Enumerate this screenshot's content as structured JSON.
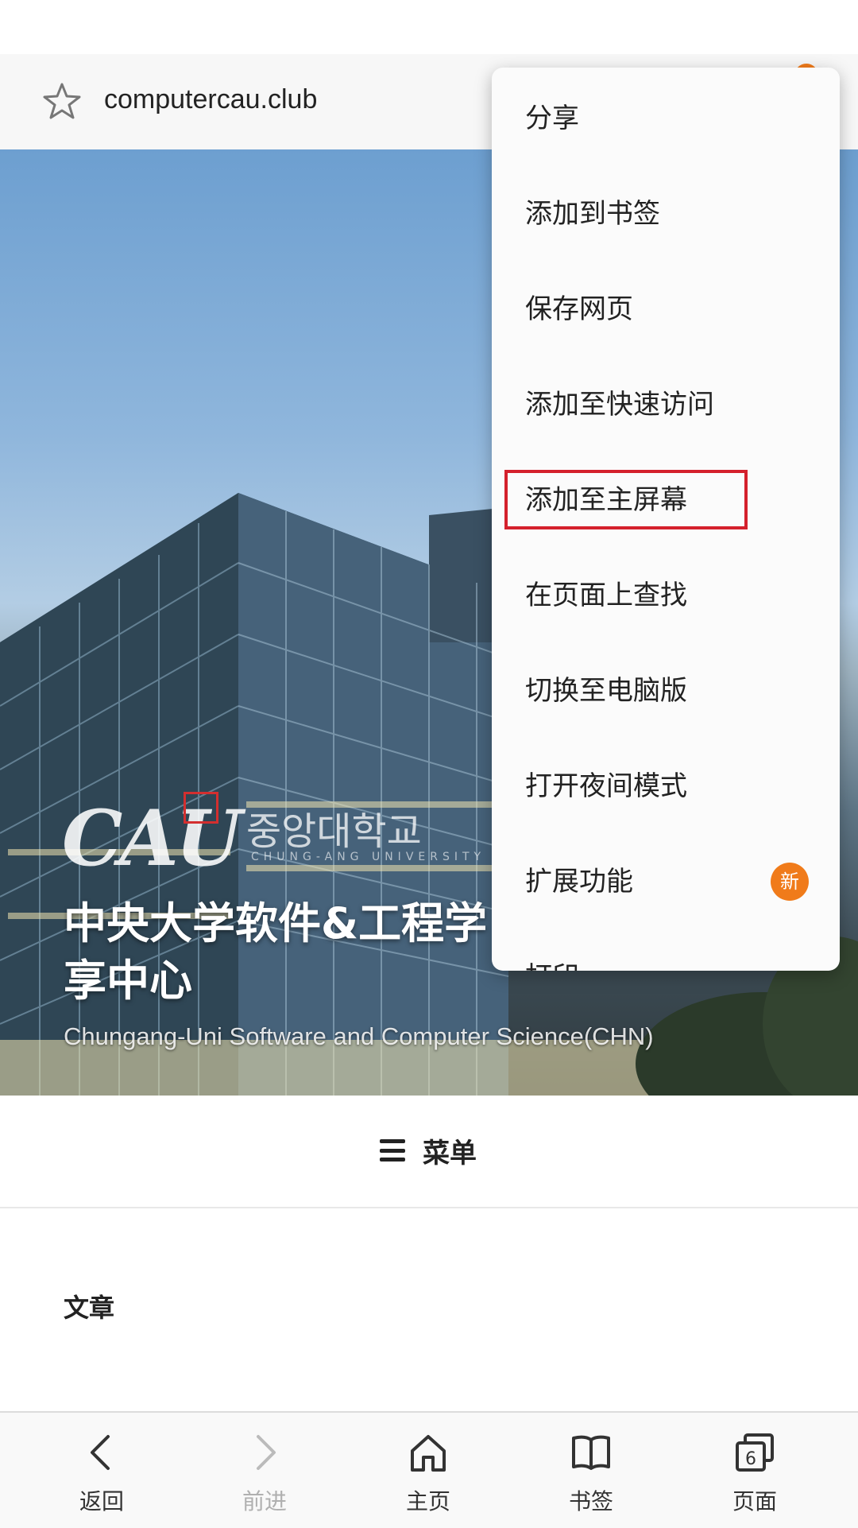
{
  "browser": {
    "url": "computercau.club"
  },
  "hero": {
    "logo_text": "CAU",
    "logo_korean": "중앙대학교",
    "logo_korean_sub": "CHUNG-ANG UNIVERSITY",
    "title_line1": "中央大学软件&工程学",
    "title_line2": "享中心",
    "subtitle": "Chungang-Uni Software and Computer Science(CHN)"
  },
  "page": {
    "menu_label": "菜单",
    "articles_heading": "文章"
  },
  "context_menu": {
    "items": [
      {
        "label": "分享"
      },
      {
        "label": "添加到书签"
      },
      {
        "label": "保存网页"
      },
      {
        "label": "添加至快速访问"
      },
      {
        "label": "添加至主屏幕",
        "highlighted": true
      },
      {
        "label": "在页面上查找"
      },
      {
        "label": "切换至电脑版"
      },
      {
        "label": "打开夜间模式"
      },
      {
        "label": "扩展功能",
        "badge": "新"
      },
      {
        "label": "打印"
      }
    ],
    "highlight_color": "#d4202c",
    "badge_color": "#f07b1a"
  },
  "bottom_nav": {
    "items": [
      {
        "label": "返回",
        "icon": "back-arrow-icon",
        "enabled": true
      },
      {
        "label": "前进",
        "icon": "forward-arrow-icon",
        "enabled": false
      },
      {
        "label": "主页",
        "icon": "home-icon",
        "enabled": true
      },
      {
        "label": "书签",
        "icon": "bookmarks-icon",
        "enabled": true
      },
      {
        "label": "页面",
        "icon": "tabs-icon",
        "enabled": true,
        "count": "6"
      }
    ]
  }
}
